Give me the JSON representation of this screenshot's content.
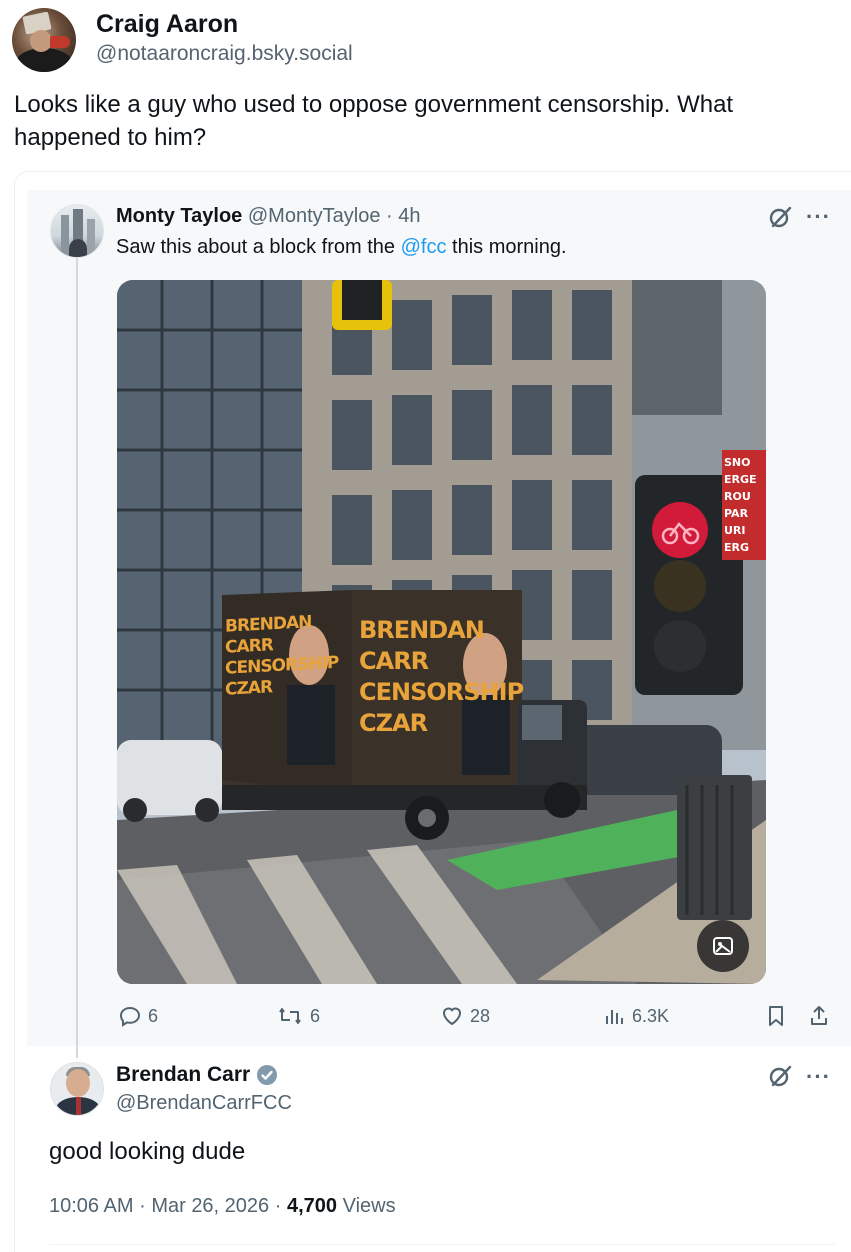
{
  "outer_post": {
    "name": "Craig Aaron",
    "handle": "@notaaroncraig.bsky.social",
    "text": "Looks like a guy who used to oppose government censorship. What happened to him?"
  },
  "quoted_tweet": {
    "name": "Monty Tayloe",
    "handle": "@MontyTayloe",
    "separator": "·",
    "age": "4h",
    "text_before": "Saw this about a block from the ",
    "mention": "@fcc",
    "text_after": " this morning.",
    "truck_signs": {
      "left_lines": [
        "BRENDAN",
        "CARR",
        "CENSORSHIP",
        "CZAR"
      ],
      "right_lines": [
        "BRENDAN",
        "CARR",
        "CENSORSHIP",
        "CZAR"
      ]
    },
    "street_sign_lines": [
      "SNO",
      "ERGE",
      "ROU",
      "PAR",
      "URI",
      "ERG"
    ],
    "actions": {
      "replies": "6",
      "reposts": "6",
      "likes": "28",
      "views": "6.3K"
    }
  },
  "reply": {
    "name": "Brendan Carr",
    "handle": "@BrendanCarrFCC",
    "text": "good looking dude",
    "time": "10:06 AM",
    "separator": "·",
    "date": "Mar 26, 2026",
    "views_count": "4,700",
    "views_label": "Views"
  },
  "icons": {
    "reply": "reply-icon",
    "repost": "repost-icon",
    "like": "heart-icon",
    "views": "views-icon",
    "bookmark": "bookmark-icon",
    "share": "share-icon",
    "grok": "grok-icon",
    "more": "more-icon",
    "verified": "verified-badge-icon",
    "alt": "image-alt-icon"
  },
  "colors": {
    "link": "#1d9bf0",
    "text": "#0f1419",
    "muted": "#536471",
    "truck_text": "#e8a33a"
  }
}
